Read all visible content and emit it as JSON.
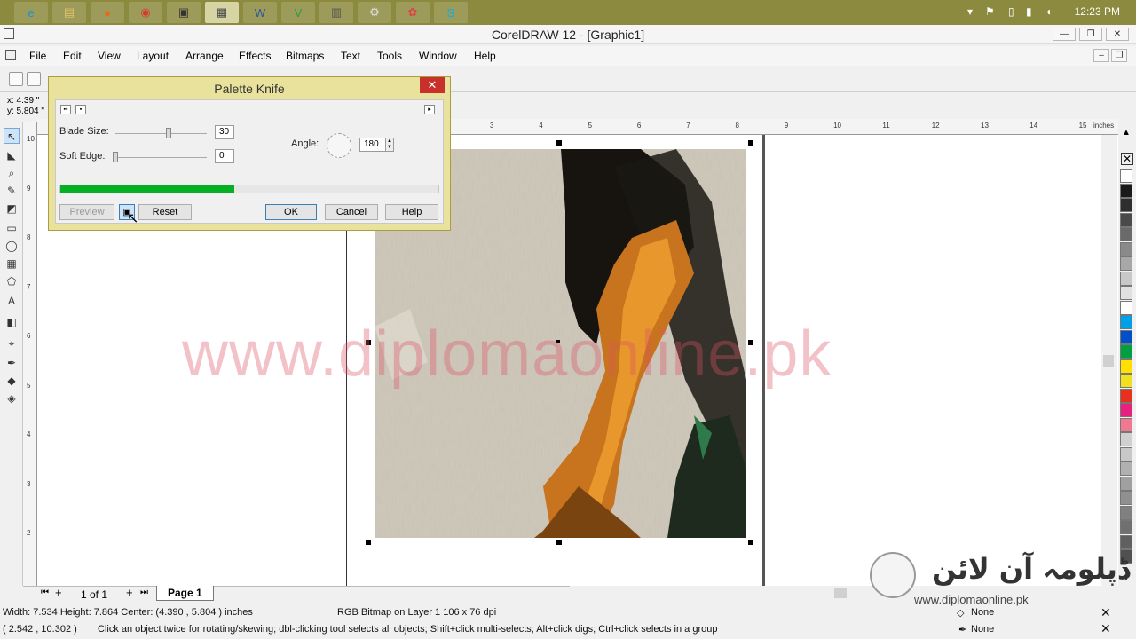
{
  "taskbar": {
    "clock": "12:23 PM",
    "apps": [
      {
        "name": "internet-explorer-icon",
        "glyph": "e",
        "color": "#1e8fd6"
      },
      {
        "name": "file-explorer-icon",
        "glyph": "▤",
        "color": "#e4c46a"
      },
      {
        "name": "firefox-icon",
        "glyph": "●",
        "color": "#e66a1e"
      },
      {
        "name": "chrome-icon",
        "glyph": "◉",
        "color": "#d73a31"
      },
      {
        "name": "media-icon",
        "glyph": "▣",
        "color": "#333"
      },
      {
        "name": "coreldraw-icon",
        "glyph": "▦",
        "color": "#444"
      },
      {
        "name": "word-icon",
        "glyph": "W",
        "color": "#2b5797"
      },
      {
        "name": "vivavideo-icon",
        "glyph": "V",
        "color": "#2a9d46"
      },
      {
        "name": "calculator-icon",
        "glyph": "▥",
        "color": "#555"
      },
      {
        "name": "network-icon",
        "glyph": "⚙",
        "color": "#ddd"
      },
      {
        "name": "paint-icon",
        "glyph": "✿",
        "color": "#d44"
      },
      {
        "name": "skype-icon",
        "glyph": "S",
        "color": "#00aff0"
      }
    ]
  },
  "window": {
    "title": "CorelDRAW 12 - [Graphic1]"
  },
  "menu": [
    "File",
    "Edit",
    "View",
    "Layout",
    "Arrange",
    "Effects",
    "Bitmaps",
    "Text",
    "Tools",
    "Window",
    "Help"
  ],
  "coords": {
    "x": "x: 4.39 \"",
    "y": "y: 5.804 \""
  },
  "ruler": {
    "top_ticks": [
      "3",
      "4",
      "5",
      "6",
      "7",
      "8",
      "9",
      "10",
      "11",
      "12",
      "13",
      "14",
      "15"
    ],
    "unit": "inches",
    "left_ticks": [
      "10",
      "9",
      "8",
      "7",
      "6",
      "5",
      "4",
      "3",
      "2"
    ]
  },
  "dialog": {
    "title": "Palette Knife",
    "blade_size_label": "Blade Size:",
    "blade_size_value": "30",
    "soft_edge_label": "Soft Edge:",
    "soft_edge_value": "0",
    "angle_label": "Angle:",
    "angle_value": "180",
    "progress": 0.46,
    "buttons": {
      "preview": "Preview",
      "reset": "Reset",
      "ok": "OK",
      "cancel": "Cancel",
      "help": "Help"
    }
  },
  "watermark": "www.diplomaonline.pk",
  "pages": {
    "counter": "1 of 1",
    "tab": "Page 1"
  },
  "status": {
    "dimensions": "Width: 7.534  Height: 7.864  Center: (4.390 , 5.804 )  inches",
    "object_info": "RGB Bitmap on Layer 1 106 x 76 dpi",
    "cursor": "( 2.542 , 10.302 )",
    "hint": "Click an object twice for rotating/skewing; dbl-clicking tool selects all objects; Shift+click multi-selects; Alt+click digs; Ctrl+click selects in a group",
    "fill": "None",
    "outline": "None"
  },
  "logo": {
    "urdu": "ڈپلومہ آن لائن",
    "url": "www.diplomaonline.pk"
  },
  "palette": [
    "#ffffff",
    "#1a1a1a",
    "#2e2e2e",
    "#4a4a4a",
    "#6a6a6a",
    "#8a8a8a",
    "#a8a8a8",
    "#c8c8c8",
    "#e0e0e0",
    "#ffffff",
    "#00a0e8",
    "#0050c8",
    "#00a040",
    "#ffe000",
    "#f0e020",
    "#e83020",
    "#e82080",
    "#f07890",
    "#d0d0d0",
    "#c8c8c8",
    "#b0b0b0",
    "#a0a0a0",
    "#909090",
    "#808080",
    "#707070",
    "#606060",
    "#505050"
  ]
}
